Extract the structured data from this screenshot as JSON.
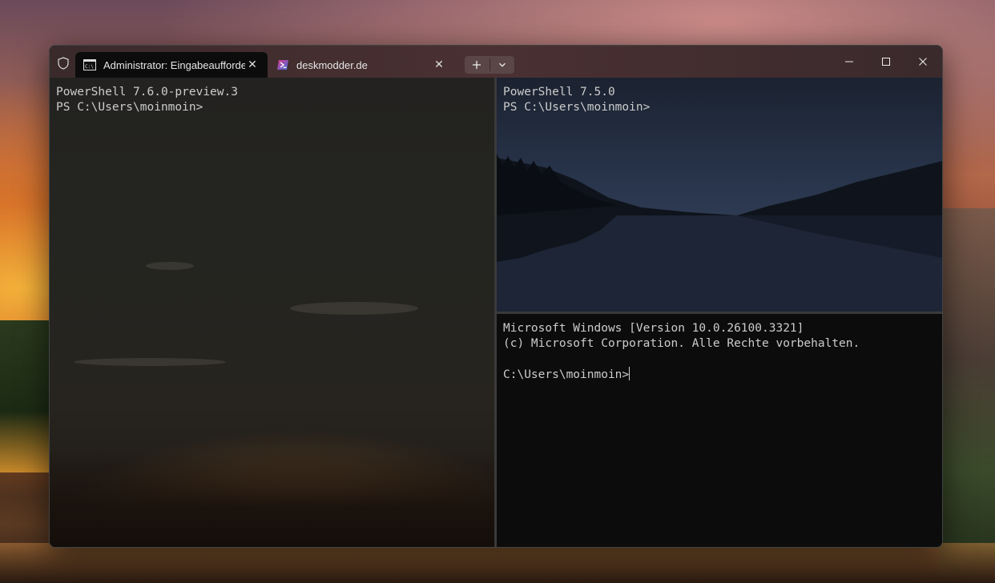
{
  "window": {
    "tabs": [
      {
        "label": "Administrator: Eingabeaufforderung",
        "icon": "cmd-icon",
        "active": true
      },
      {
        "label": "deskmodder.de",
        "icon": "powershell-icon",
        "active": false
      }
    ],
    "new_tab_symbol": "+",
    "dropdown_symbol": "⌄",
    "caption": {
      "minimize": "minimize-icon",
      "maximize": "maximize-icon",
      "close": "close-icon"
    }
  },
  "panes": {
    "left": {
      "lines": [
        "PowerShell 7.6.0-preview.3",
        "PS C:\\Users\\moinmoin>"
      ]
    },
    "right_top": {
      "lines": [
        "PowerShell 7.5.0",
        "PS C:\\Users\\moinmoin>"
      ]
    },
    "right_bottom": {
      "lines": [
        "Microsoft Windows [Version 10.0.26100.3321]",
        "(c) Microsoft Corporation. Alle Rechte vorbehalten.",
        "",
        "C:\\Users\\moinmoin>"
      ]
    }
  },
  "colors": {
    "terminal_text": "#cccccc",
    "terminal_bg": "#0c0c0c",
    "titlebar": "#3a2a2c"
  }
}
